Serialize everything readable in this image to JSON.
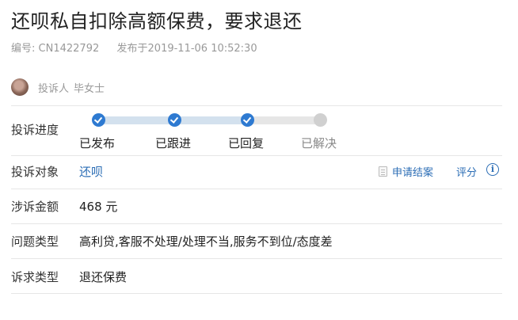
{
  "complaint": {
    "title": "还呗私自扣除高额保费，要求退还",
    "id_label": "编号:",
    "id_value": "CN1422792",
    "published_label": "发布于",
    "published_value": "2019-11-06 10:52:30"
  },
  "author": {
    "label": "投诉人",
    "name": "毕女士"
  },
  "progress": {
    "label": "投诉进度",
    "steps": [
      {
        "label": "已发布",
        "done": true
      },
      {
        "label": "已跟进",
        "done": true
      },
      {
        "label": "已回复",
        "done": true
      },
      {
        "label": "已解决",
        "done": false
      }
    ]
  },
  "target": {
    "label": "投诉对象",
    "value": "还呗",
    "apply_close_label": "申请结案",
    "rate_label": "评分",
    "info_icon": "info-icon"
  },
  "amount": {
    "label": "涉诉金额",
    "value": "468 元"
  },
  "issue_type": {
    "label": "问题类型",
    "value": "高利贷,客服不处理/处理不当,服务不到位/态度差"
  },
  "demand_type": {
    "label": "诉求类型",
    "value": "退还保费"
  },
  "colors": {
    "accent": "#2e7ad1",
    "link": "#2b6db5",
    "progress_done": "#d3e1ee",
    "progress_todo": "#e6e6e6"
  }
}
